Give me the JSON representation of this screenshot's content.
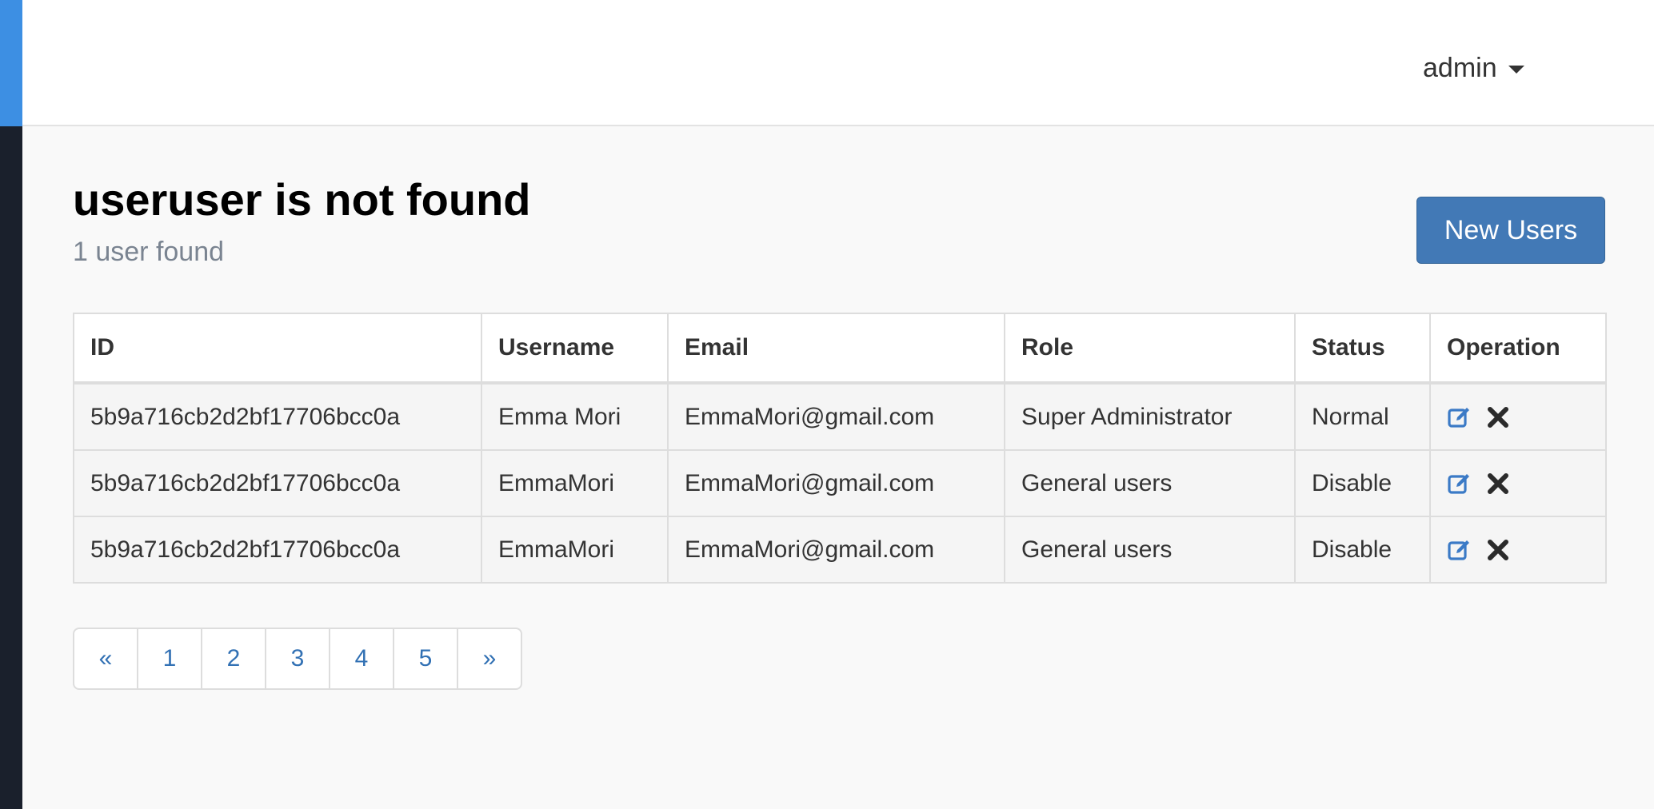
{
  "header": {
    "user_name": "admin"
  },
  "page": {
    "title": "useruser is not found",
    "subtitle": "1 user found",
    "new_button_label": "New Users"
  },
  "table": {
    "columns": [
      "ID",
      "Username",
      "Email",
      "Role",
      "Status",
      "Operation"
    ],
    "rows": [
      {
        "id": "5b9a716cb2d2bf17706bcc0a",
        "username": "Emma Mori",
        "email": "EmmaMori@gmail.com",
        "role": "Super Administrator",
        "status": "Normal"
      },
      {
        "id": "5b9a716cb2d2bf17706bcc0a",
        "username": "EmmaMori",
        "email": "EmmaMori@gmail.com",
        "role": "General users",
        "status": "Disable"
      },
      {
        "id": "5b9a716cb2d2bf17706bcc0a",
        "username": "EmmaMori",
        "email": "EmmaMori@gmail.com",
        "role": "General users",
        "status": "Disable"
      }
    ],
    "operation_icons": [
      "edit-icon",
      "delete-icon"
    ]
  },
  "pagination": {
    "prev_label": "«",
    "pages": [
      "1",
      "2",
      "3",
      "4",
      "5"
    ],
    "next_label": "»"
  },
  "colors": {
    "accent": "#3d8fe3",
    "sidebar": "#1a202c",
    "primary_button": "#4279b6",
    "link": "#3271b4",
    "edit_icon": "#3b7ac6"
  }
}
